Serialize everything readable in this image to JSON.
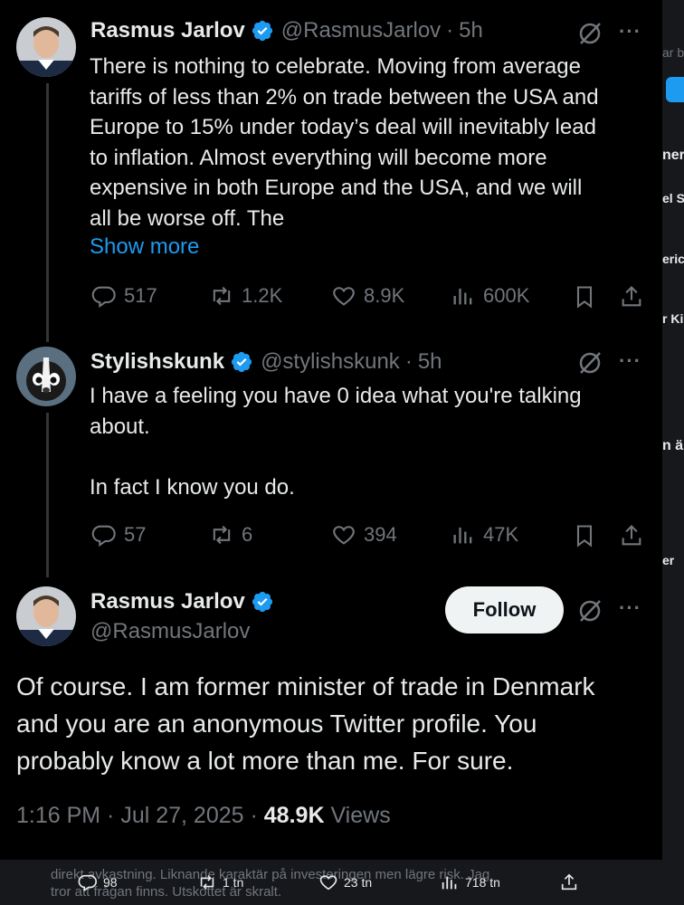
{
  "tweets": [
    {
      "name": "Rasmus Jarlov",
      "handle": "@RasmusJarlov",
      "time": "5h",
      "lines": [
        "There is nothing to celebrate. Moving from average",
        "tariffs of less than 2% on trade between the USA and",
        "Europe to 15% under today’s deal will inevitably lead",
        "to inflation. Almost everything will become more",
        "expensive in both Europe and the USA, and we will",
        "all be worse off. The"
      ],
      "show_more": "Show more",
      "replies": "517",
      "reposts": "1.2K",
      "likes": "8.9K",
      "views": "600K"
    },
    {
      "name": "Stylishskunk",
      "handle": "@stylishskunk",
      "time": "5h",
      "lines": [
        "I have a feeling you have 0 idea what you're talking",
        "about.",
        "",
        "In fact I know you do."
      ],
      "replies": "57",
      "reposts": "6",
      "likes": "394",
      "views": "47K"
    }
  ],
  "main_tweet": {
    "name": "Rasmus Jarlov",
    "handle": "@RasmusJarlov",
    "follow_label": "Follow",
    "lines": [
      "Of course. I am former minister of trade in Denmark",
      "and you are an anonymous Twitter profile. You",
      "probably know a lot more than me. For sure."
    ],
    "timestamp": "1:16 PM · Jul 27, 2025",
    "sep": "·",
    "views_count": "48.9K",
    "views_label": "Views"
  },
  "background": {
    "line1": "direkt avkastning. Liknande karaktär på investeringen men lägre risk. Jag",
    "line2": "tror att frågan finns. Utskottet är skralt.",
    "replies": "98",
    "reposts": "1 tn",
    "likes": "23 tn",
    "views": "718 tn"
  },
  "right_strip": [
    "ar b",
    "ner",
    "el S",
    "eric",
    "r Ki",
    "n ä",
    "er"
  ],
  "colors": {
    "accent": "#1d9bf0",
    "muted": "#71767b",
    "text": "#e7e9ea",
    "bg": "#000000"
  }
}
